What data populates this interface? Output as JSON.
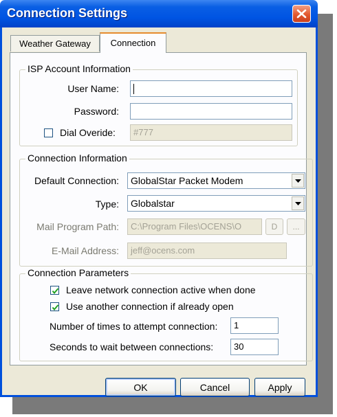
{
  "window": {
    "title": "Connection Settings"
  },
  "tabs": [
    {
      "label": "Weather Gateway"
    },
    {
      "label": "Connection"
    }
  ],
  "isp": {
    "group_label": "ISP Account Information",
    "username_label": "User Name:",
    "username_value": "",
    "password_label": "Password:",
    "password_value": "",
    "dial_override_label": "Dial Overide:",
    "dial_override_checked": false,
    "dial_override_value": "#777"
  },
  "connection": {
    "group_label": "Connection Information",
    "default_label": "Default Connection:",
    "default_value": "GlobalStar Packet Modem",
    "type_label": "Type:",
    "type_value": "Globalstar",
    "mail_path_label": "Mail Program Path:",
    "mail_path_value": "C:\\Program Files\\OCENS\\O",
    "mail_path_button": "D",
    "mail_path_browse": "...",
    "email_label": "E-Mail Address:",
    "email_value": "jeff@ocens.com"
  },
  "parameters": {
    "group_label": "Connection Parameters",
    "leave_active_label": "Leave network connection active when done",
    "leave_active_checked": true,
    "use_another_label": "Use another connection if already open",
    "use_another_checked": true,
    "attempts_label": "Number of times to attempt connection:",
    "attempts_value": "1",
    "wait_label": "Seconds to wait between connections:",
    "wait_value": "30"
  },
  "buttons": {
    "ok": "OK",
    "cancel": "Cancel",
    "apply": "Apply"
  },
  "colors": {
    "titlebar": "#0054e3",
    "dialog_bg": "#ece9d8",
    "close": "#e2582f",
    "active_tab_accent": "#e68b2c"
  }
}
